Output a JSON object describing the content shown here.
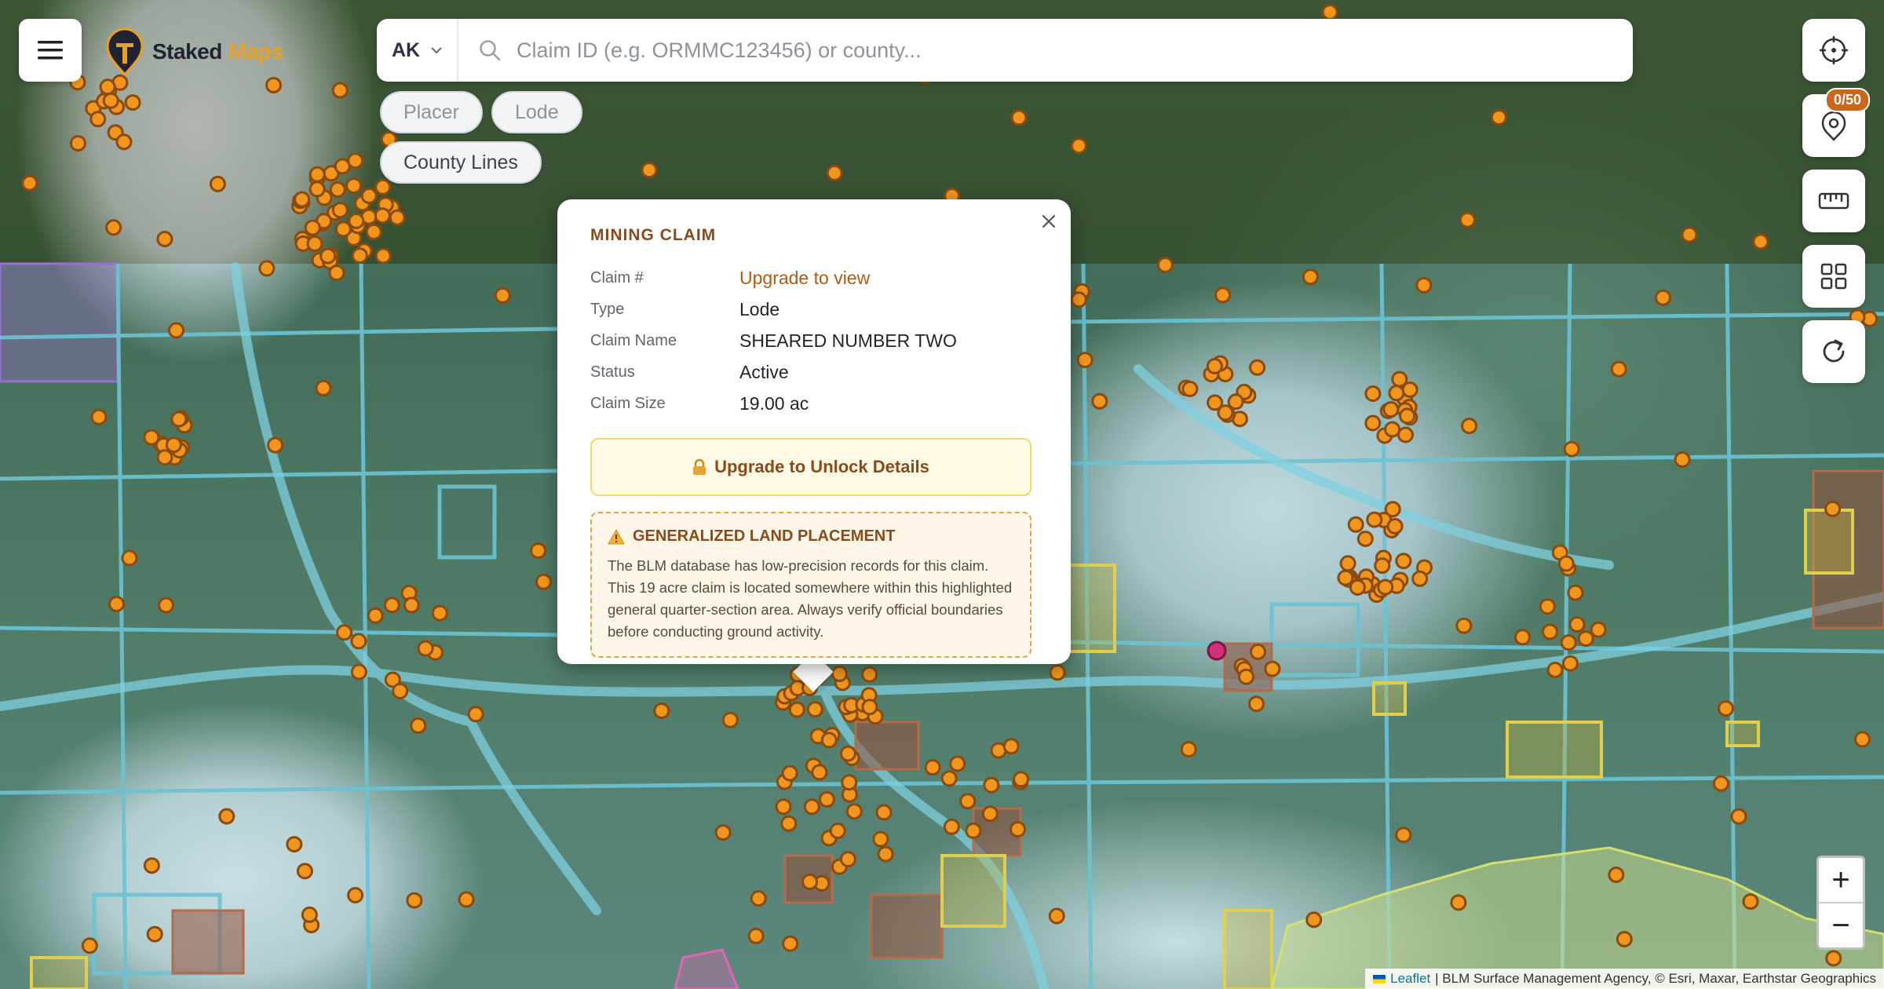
{
  "header": {
    "logo_word1": "Staked",
    "logo_word2": "Maps",
    "state": "AK",
    "search_placeholder": "Claim ID (e.g. ORMMC123456) or county..."
  },
  "filters": [
    {
      "label": "Placer"
    },
    {
      "label": "Lode"
    },
    {
      "label": "County Lines"
    }
  ],
  "tools": {
    "saved_badge": "0/50"
  },
  "zoom": {
    "in": "+",
    "out": "−"
  },
  "attribution": {
    "leaflet": "Leaflet",
    "text": "| BLM Surface Management Agency, © Esri, Maxar, Earthstar Geographics"
  },
  "popup": {
    "title": "MINING CLAIM",
    "rows": [
      {
        "key": "Claim #",
        "value": "Upgrade to view"
      },
      {
        "key": "Type",
        "value": "Lode"
      },
      {
        "key": "Claim Name",
        "value": "SHEARED NUMBER TWO"
      },
      {
        "key": "Status",
        "value": "Active"
      },
      {
        "key": "Claim Size",
        "value": "19.00 ac"
      }
    ],
    "unlock_label": "Upgrade to Unlock Details",
    "notice_title": "GENERALIZED LAND PLACEMENT",
    "notice_body": "The BLM database has low-precision records for this claim. This 19 acre claim is located somewhere within this highlighted general quarter-section area. Always verify official boundaries before conducting ground activity."
  },
  "colors": {
    "brand_orange": "#e8a128",
    "claim_marker": "#f0961e",
    "blm_overlay": "#5fb6c8",
    "popup_accent": "#8a4a1a"
  }
}
